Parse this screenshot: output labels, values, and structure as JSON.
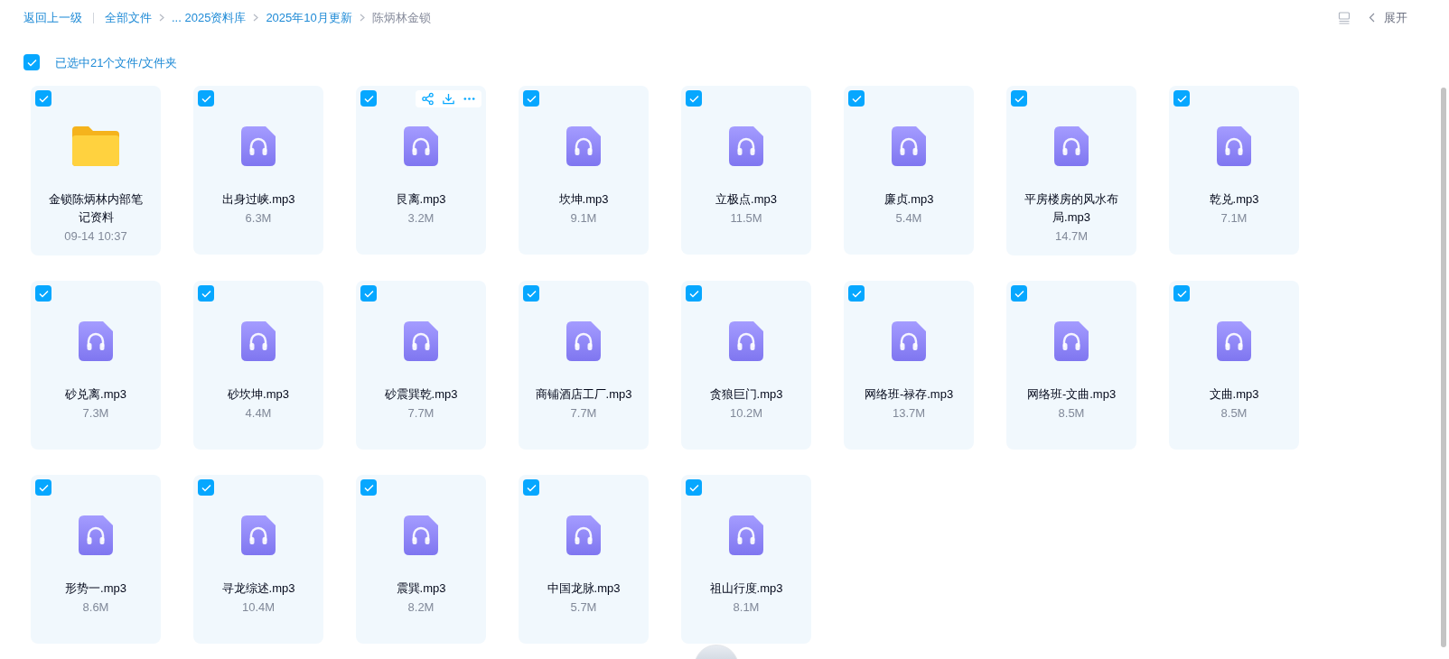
{
  "breadcrumb": {
    "back": "返回上一级",
    "items": [
      {
        "label": "全部文件",
        "current": false
      },
      {
        "label": "... 2025资料库",
        "current": false
      },
      {
        "label": "2025年10月更新",
        "current": false
      },
      {
        "label": "陈炳林金锁",
        "current": true
      }
    ]
  },
  "toolbar": {
    "expand": "展开"
  },
  "selection": {
    "checked": true,
    "label": "已选中21个文件/文件夹"
  },
  "files": [
    {
      "kind": "folder",
      "name": "金锁陈炳林内部笔记资料",
      "meta": "09-14 10:37",
      "checked": true,
      "actions_shown": false
    },
    {
      "kind": "audio",
      "name": "出身过峡.mp3",
      "meta": "6.3M",
      "checked": true,
      "actions_shown": false
    },
    {
      "kind": "audio",
      "name": "艮离.mp3",
      "meta": "3.2M",
      "checked": true,
      "actions_shown": true
    },
    {
      "kind": "audio",
      "name": "坎坤.mp3",
      "meta": "9.1M",
      "checked": true,
      "actions_shown": false
    },
    {
      "kind": "audio",
      "name": "立极点.mp3",
      "meta": "11.5M",
      "checked": true,
      "actions_shown": false
    },
    {
      "kind": "audio",
      "name": "廉贞.mp3",
      "meta": "5.4M",
      "checked": true,
      "actions_shown": false
    },
    {
      "kind": "audio",
      "name": "平房楼房的风水布局.mp3",
      "meta": "14.7M",
      "checked": true,
      "actions_shown": false
    },
    {
      "kind": "audio",
      "name": "乾兑.mp3",
      "meta": "7.1M",
      "checked": true,
      "actions_shown": false
    },
    {
      "kind": "audio",
      "name": "砂兑离.mp3",
      "meta": "7.3M",
      "checked": true,
      "actions_shown": false
    },
    {
      "kind": "audio",
      "name": "砂坎坤.mp3",
      "meta": "4.4M",
      "checked": true,
      "actions_shown": false
    },
    {
      "kind": "audio",
      "name": "砂震巽乾.mp3",
      "meta": "7.7M",
      "checked": true,
      "actions_shown": false
    },
    {
      "kind": "audio",
      "name": "商铺酒店工厂.mp3",
      "meta": "7.7M",
      "checked": true,
      "actions_shown": false
    },
    {
      "kind": "audio",
      "name": "贪狼巨门.mp3",
      "meta": "10.2M",
      "checked": true,
      "actions_shown": false
    },
    {
      "kind": "audio",
      "name": "网络班-禄存.mp3",
      "meta": "13.7M",
      "checked": true,
      "actions_shown": false
    },
    {
      "kind": "audio",
      "name": "网络班-文曲.mp3",
      "meta": "8.5M",
      "checked": true,
      "actions_shown": false
    },
    {
      "kind": "audio",
      "name": "文曲.mp3",
      "meta": "8.5M",
      "checked": true,
      "actions_shown": false
    },
    {
      "kind": "audio",
      "name": "形势一.mp3",
      "meta": "8.6M",
      "checked": true,
      "actions_shown": false
    },
    {
      "kind": "audio",
      "name": "寻龙综述.mp3",
      "meta": "10.4M",
      "checked": true,
      "actions_shown": false
    },
    {
      "kind": "audio",
      "name": "震巽.mp3",
      "meta": "8.2M",
      "checked": true,
      "actions_shown": false
    },
    {
      "kind": "audio",
      "name": "中国龙脉.mp3",
      "meta": "5.7M",
      "checked": true,
      "actions_shown": false
    },
    {
      "kind": "audio",
      "name": "祖山行度.mp3",
      "meta": "8.1M",
      "checked": true,
      "actions_shown": false
    }
  ]
}
